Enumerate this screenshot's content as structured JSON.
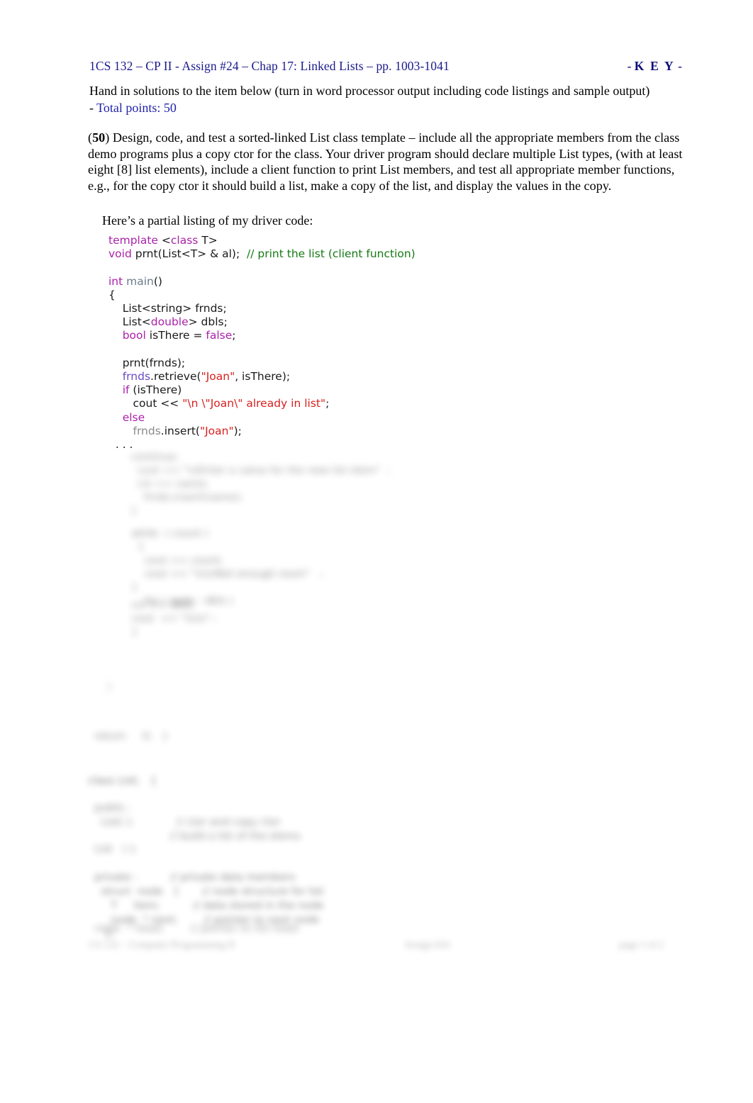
{
  "header": {
    "title": "1CS 132 – CP II - Assign #24 – Chap 17: Linked Lists – pp. 1003-1041",
    "key_prefix": "- ",
    "key_letters": "K E Y",
    "key_suffix": " -",
    "title_color": "#1a1a8c"
  },
  "intro": {
    "text_before": "Hand in solutions to the item below (turn in word processor output including code listings and sample output) - ",
    "points_label": "Total points:  50",
    "points_color": "#2222aa"
  },
  "prompt": {
    "open_paren": "(",
    "points": "50",
    "close_paren": ") ",
    "body": "Design, code, and test a sorted-linked List class template – include all the appropriate members from the class demo programs plus a copy ctor for the class. Your driver program should declare multiple List types, (with at least eight [8] list elements), include a client function to print List members, and test all appropriate member functions, e.g., for the copy ctor it should build a list, make a copy of the list, and display the values in the copy."
  },
  "listing": {
    "lead": "Here’s a partial listing of my driver code:"
  },
  "code_colors": {
    "keyword": "#aa22aa",
    "comment": "#157a15",
    "string": "#d82020",
    "function": "#6b7b8c",
    "identifier_purple": "#6a4bc8",
    "identifier_gray": "#8b8b8b",
    "plain": "#1a1a1a"
  },
  "code_lines": [
    {
      "id": "line-template",
      "tokens": [
        {
          "t": "template ",
          "c": "kw"
        },
        {
          "t": "<",
          "c": "plain"
        },
        {
          "t": "class",
          "c": "kw"
        },
        {
          "t": " T>",
          "c": "plain"
        }
      ]
    },
    {
      "id": "line-prnt-proto",
      "tokens": [
        {
          "t": "void",
          "c": "kw"
        },
        {
          "t": " prnt(List<T> & al);  ",
          "c": "plain"
        },
        {
          "t": "// print the list (client function)",
          "c": "cmt"
        }
      ]
    },
    {
      "id": "line-blank-1",
      "tokens": [
        {
          "t": " ",
          "c": "plain"
        }
      ]
    },
    {
      "id": "line-int-main",
      "tokens": [
        {
          "t": "int ",
          "c": "kw"
        },
        {
          "t": "main",
          "c": "fn"
        },
        {
          "t": "()",
          "c": "plain"
        }
      ]
    },
    {
      "id": "line-open-brace",
      "tokens": [
        {
          "t": "{",
          "c": "plain"
        }
      ]
    },
    {
      "id": "line-list-string",
      "tokens": [
        {
          "t": "    List<string> frnds;",
          "c": "plain"
        }
      ]
    },
    {
      "id": "line-list-double",
      "tokens": [
        {
          "t": "    List<",
          "c": "plain"
        },
        {
          "t": "double",
          "c": "kw"
        },
        {
          "t": "> dbls;",
          "c": "plain"
        }
      ]
    },
    {
      "id": "line-bool-isthere",
      "tokens": [
        {
          "t": "    ",
          "c": "plain"
        },
        {
          "t": "bool",
          "c": "kw"
        },
        {
          "t": " isThere = ",
          "c": "plain"
        },
        {
          "t": "false",
          "c": "kw"
        },
        {
          "t": ";",
          "c": "plain"
        }
      ]
    },
    {
      "id": "line-blank-2",
      "tokens": [
        {
          "t": " ",
          "c": "plain"
        }
      ]
    },
    {
      "id": "line-prnt-call",
      "tokens": [
        {
          "t": "    prnt(frnds);",
          "c": "plain"
        }
      ]
    },
    {
      "id": "line-retrieve",
      "tokens": [
        {
          "t": "    ",
          "c": "plain"
        },
        {
          "t": "frnds",
          "c": "id-pur"
        },
        {
          "t": ".retrieve(",
          "c": "plain"
        },
        {
          "t": "\"Joan\"",
          "c": "str"
        },
        {
          "t": ", isThere);",
          "c": "plain"
        }
      ]
    },
    {
      "id": "line-if",
      "tokens": [
        {
          "t": "    ",
          "c": "plain"
        },
        {
          "t": "if",
          "c": "kw"
        },
        {
          "t": " (isThere)",
          "c": "plain"
        }
      ]
    },
    {
      "id": "line-cout",
      "tokens": [
        {
          "t": "       cout << ",
          "c": "plain"
        },
        {
          "t": "\"\\n \\\"Joan\\\" already in list\"",
          "c": "str"
        },
        {
          "t": ";",
          "c": "plain"
        }
      ]
    },
    {
      "id": "line-else",
      "tokens": [
        {
          "t": "    ",
          "c": "plain"
        },
        {
          "t": "else",
          "c": "kw"
        }
      ]
    },
    {
      "id": "line-insert",
      "tokens": [
        {
          "t": "       ",
          "c": "plain"
        },
        {
          "t": "frnds",
          "c": "id-gry"
        },
        {
          "t": ".insert(",
          "c": "plain"
        },
        {
          "t": "\"Joan\"",
          "c": "str"
        },
        {
          "t": ");",
          "c": "plain"
        }
      ]
    },
    {
      "id": "line-ellipsis",
      "tokens": [
        {
          "t": "  . . .",
          "c": "plain"
        }
      ]
    }
  ],
  "obscured": {
    "note": "blurred-illegible-content",
    "block_a": "  continue;\n    cout << \"\\nEnter a value for the new list elem\"  ;\n    cin >> name;\n      frnds.insert(name);\n  }",
    "block_b": "  while  ( count )\n    {\n      cout << count;\n      cout << \"\\n\\nNot enough room\"   ;\n  }\n      for ( node : dbls )",
    "block_c": "  cin >> dbls;\n  cout  << \"\\n\\n\" ;\n  }",
    "block_d": "}",
    "block_e": "  return     0;   }",
    "block_f": "class List;   {",
    "block_g": "  public :\n    List( );             // ctor and copy ctor\n                         // build a list of the elems",
    "block_h": "  List   ( );",
    "block_i": "  private :          // private data members\n    struct  node   {       // node structure for list\n       T     item;          // data stored in the node\n       node  * next;        // pointer to next node\n     };",
    "block_j": "  node  * head;        // pointer to list head"
  },
  "footer": {
    "left": "CS 132 – Computer Programming II",
    "center": "Assign #24",
    "right": "page 1 of 2"
  }
}
